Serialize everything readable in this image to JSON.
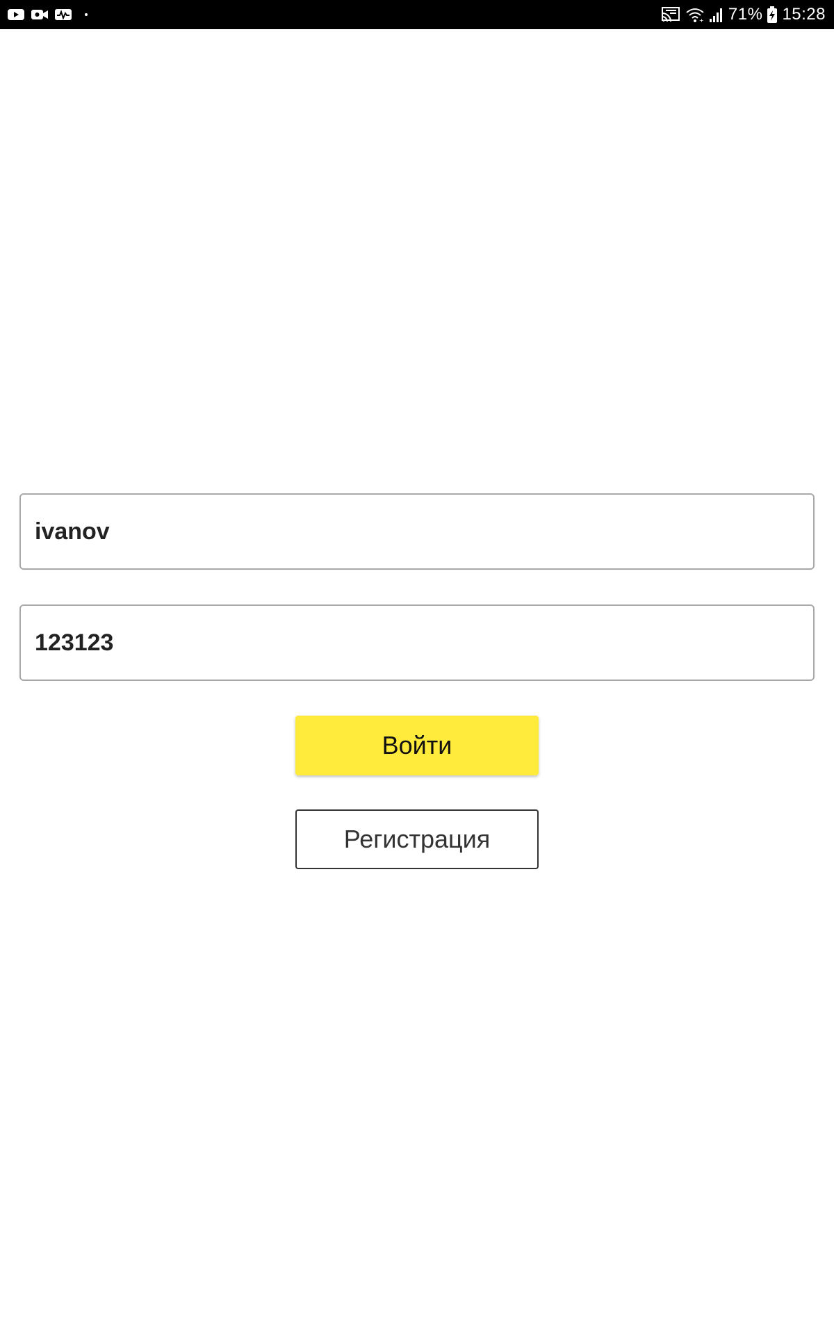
{
  "status_bar": {
    "left_icons": [
      "youtube-icon",
      "video-camera-icon",
      "activity-icon",
      "dot-icon"
    ],
    "right_icons": [
      "cast-icon",
      "wifi-icon",
      "signal-icon",
      "battery-charging-icon"
    ],
    "battery_percent": "71%",
    "time": "15:28"
  },
  "form": {
    "login_value": "ivanov",
    "password_value": "123123",
    "login_button_label": "Войти",
    "register_button_label": "Регистрация"
  },
  "colors": {
    "primary_button": "#ffeb3b",
    "field_border": "#a9a9a9",
    "secondary_button_border": "#333333"
  }
}
